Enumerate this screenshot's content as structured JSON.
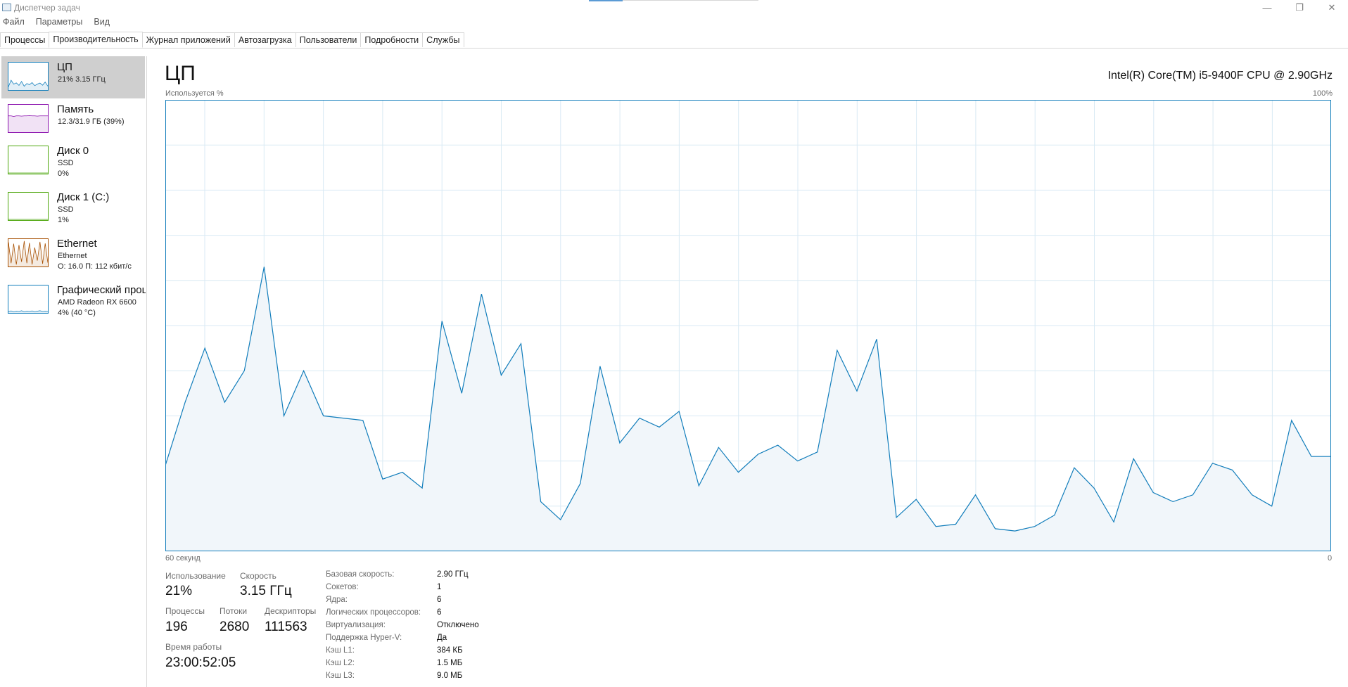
{
  "window": {
    "title": "Диспетчер задач",
    "controls": {
      "minimize": "—",
      "maximize": "❐",
      "close": "✕"
    }
  },
  "menu": [
    "Файл",
    "Параметры",
    "Вид"
  ],
  "tabs": [
    {
      "label": "Процессы",
      "active": false
    },
    {
      "label": "Производительность",
      "active": true
    },
    {
      "label": "Журнал приложений",
      "active": false
    },
    {
      "label": "Автозагрузка",
      "active": false
    },
    {
      "label": "Пользователи",
      "active": false
    },
    {
      "label": "Подробности",
      "active": false
    },
    {
      "label": "Службы",
      "active": false
    }
  ],
  "sidebar": {
    "items": [
      {
        "title": "ЦП",
        "line1": "21% 3.15 ГГц",
        "line2": "",
        "color": "#117dbb",
        "selected": true
      },
      {
        "title": "Память",
        "line1": "12.3/31.9 ГБ (39%)",
        "line2": "",
        "color": "#8b12ae",
        "selected": false
      },
      {
        "title": "Диск 0",
        "line1": "SSD",
        "line2": "0%",
        "color": "#4da60c",
        "selected": false
      },
      {
        "title": "Диск 1 (C:)",
        "line1": "SSD",
        "line2": "1%",
        "color": "#4da60c",
        "selected": false
      },
      {
        "title": "Ethernet",
        "line1": "Ethernet",
        "line2_caps": "О: 16.0 П: 112 кбит/с",
        "color": "#a74f01",
        "selected": false
      },
      {
        "title": "Графический процессор",
        "line1": "AMD Radeon RX 6600",
        "line2": "4% (40 °C)",
        "color": "#117dbb",
        "selected": false
      }
    ]
  },
  "main": {
    "title": "ЦП",
    "cpu_name": "Intel(R) Core(TM) i5-9400F CPU @ 2.90GHz",
    "y_axis_label": "Используется %",
    "y_max_label": "100%",
    "x_left_label": "60 секунд",
    "x_right_label": "0"
  },
  "chart_data": {
    "type": "area",
    "xlabel": "60 секунд",
    "ylabel": "Используется %",
    "ylim": [
      0,
      100
    ],
    "xlim": [
      0,
      60
    ],
    "grid": true,
    "series": [
      {
        "values": [
          19,
          33,
          45,
          33,
          40,
          63,
          30,
          40,
          30,
          29.5,
          29,
          16,
          17.5,
          14,
          51,
          35,
          57,
          39,
          46,
          11,
          7,
          15,
          41,
          24,
          29.5,
          27.5,
          31,
          14.5,
          23,
          17.5,
          21.5,
          23.5,
          20,
          22,
          44.5,
          35.5,
          47,
          7.5,
          11.5,
          5.5,
          6,
          12.5,
          5,
          4.5,
          5.5,
          8,
          18.5,
          14,
          6.5,
          20.5,
          13,
          11,
          12.5,
          19.5,
          18,
          12.5,
          10,
          29,
          21,
          21
        ]
      }
    ],
    "color": "#117dbb",
    "fill": "#f1f6fa"
  },
  "stats": {
    "usage_label": "Использование",
    "usage_value": "21%",
    "speed_label": "Скорость",
    "speed_value": "3.15 ГГц",
    "processes_label": "Процессы",
    "processes_value": "196",
    "threads_label": "Потоки",
    "threads_value": "2680",
    "handles_label": "Дескрипторы",
    "handles_value": "111563",
    "uptime_label": "Время работы",
    "uptime_value": "23:00:52:05"
  },
  "info": [
    {
      "label": "Базовая скорость:",
      "value": "2.90 ГГц"
    },
    {
      "label": "Сокетов:",
      "value": "1"
    },
    {
      "label": "Ядра:",
      "value": "6"
    },
    {
      "label": "Логических процессоров:",
      "value": "6"
    },
    {
      "label": "Виртуализация:",
      "value": "Отключено"
    },
    {
      "label": "Поддержка Hyper-V:",
      "value": "Да"
    },
    {
      "label": "Кэш L1:",
      "value": "384 КБ"
    },
    {
      "label": "Кэш L2:",
      "value": "1.5 МБ"
    },
    {
      "label": "Кэш L3:",
      "value": "9.0 МБ"
    }
  ],
  "sparklines": {
    "cpu": [
      10,
      35,
      20,
      25,
      15,
      30,
      12,
      22,
      18,
      26,
      14,
      20,
      24,
      16,
      28,
      12
    ],
    "memory": [
      60,
      60,
      58,
      60,
      60,
      59,
      60,
      60,
      61,
      60,
      60,
      59,
      60,
      60,
      60,
      60
    ],
    "disk0": [
      0,
      0,
      0,
      0,
      0,
      0,
      0,
      0,
      0,
      0,
      0,
      0,
      0,
      0,
      0,
      0
    ],
    "disk1": [
      0,
      0,
      0,
      0,
      0,
      0,
      0,
      0,
      0,
      0,
      0,
      0,
      0,
      0,
      0,
      0
    ],
    "ethernet": [
      90,
      10,
      85,
      5,
      80,
      15,
      95,
      10,
      88,
      5,
      70,
      20,
      92,
      8,
      86,
      12
    ],
    "gpu": [
      3,
      5,
      2,
      4,
      3,
      6,
      2,
      4,
      3,
      5,
      2,
      4,
      6,
      3,
      4,
      3
    ]
  }
}
